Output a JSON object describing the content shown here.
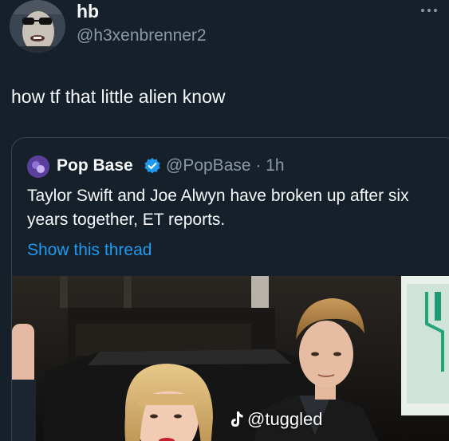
{
  "author": {
    "name": "hb",
    "handle": "@h3xenbrenner2"
  },
  "tweet": {
    "text": "how tf that little alien know"
  },
  "quoted_tweet": {
    "name": "Pop Base",
    "handle_time": "@PopBase · 1h",
    "text": "Taylor Swift and Joe Alwyn have broken up after six years together, ET reports.",
    "show_thread_label": "Show this thread"
  },
  "watermark": {
    "text": "@tuggled"
  },
  "colors": {
    "background": "#15202b",
    "link": "#1d9bf0",
    "verified": "#1d9bf0",
    "secondary_text": "#8b98a5"
  },
  "icons": {
    "more": "more-horizontal-icon",
    "verified": "verified-badge-icon",
    "tiktok": "tiktok-logo-icon"
  }
}
